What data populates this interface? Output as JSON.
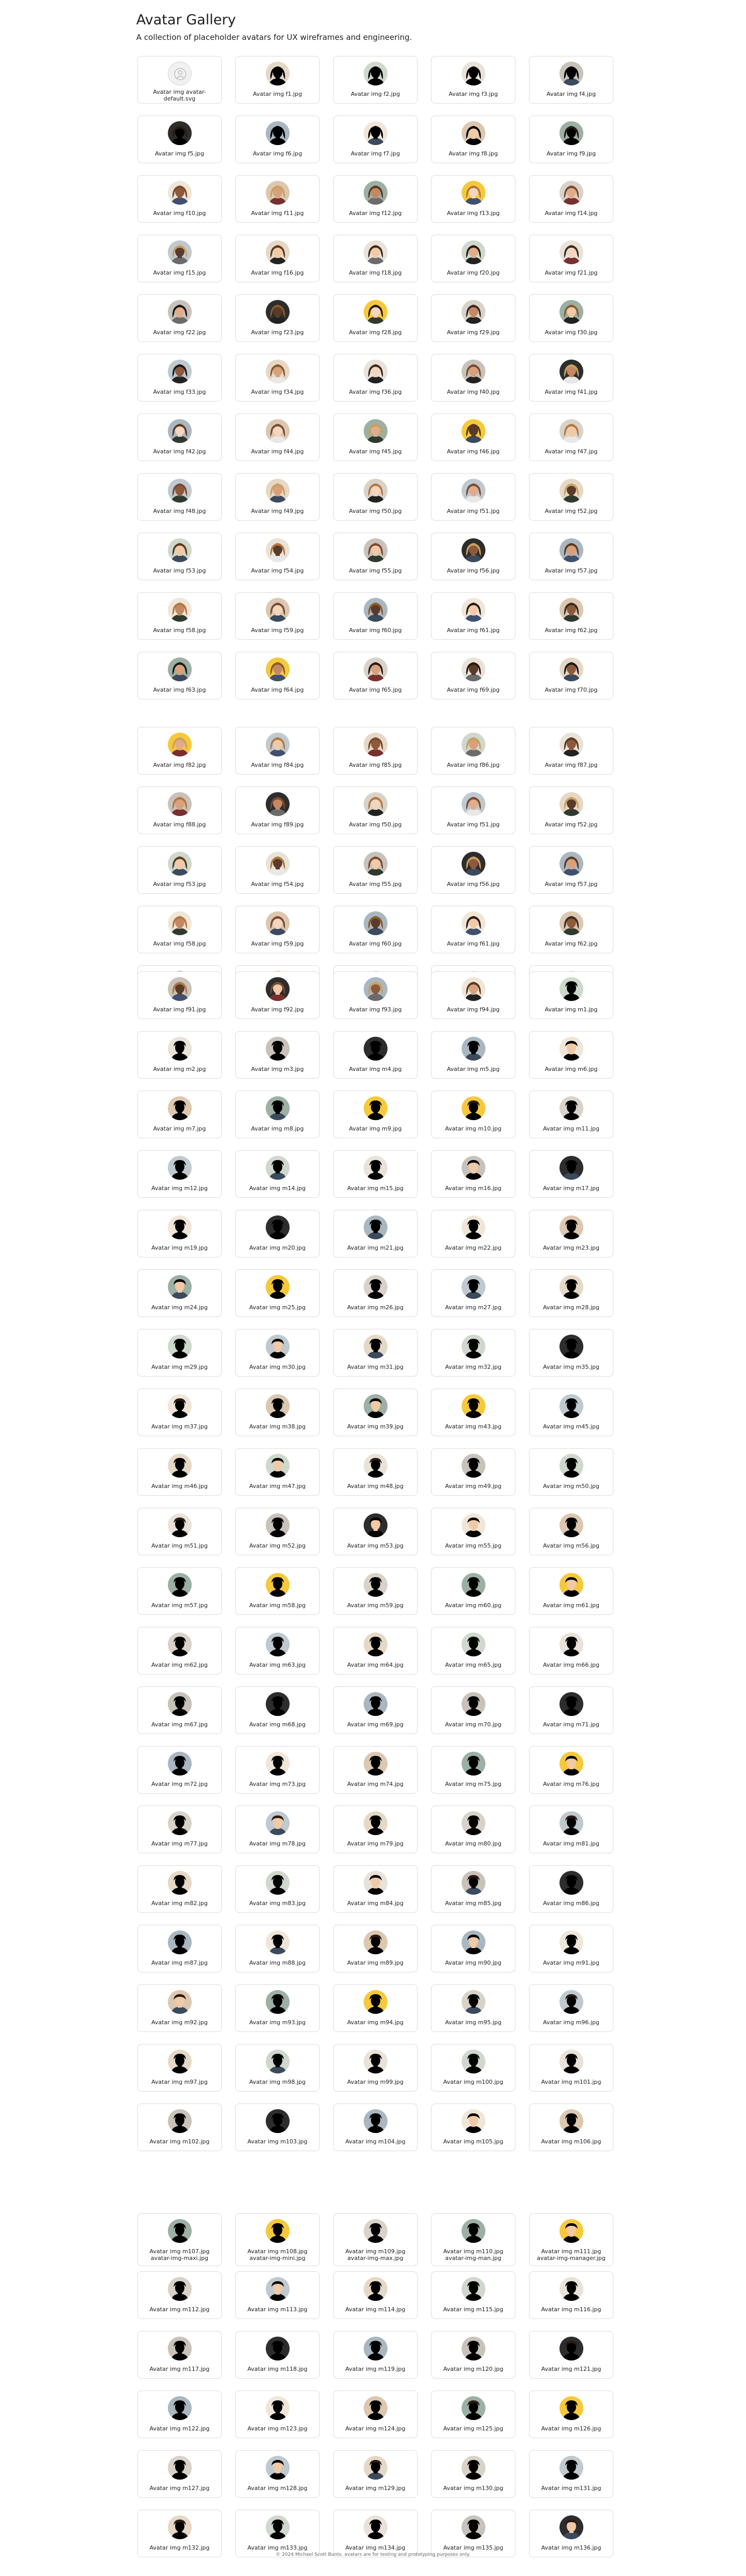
{
  "page": {
    "title": "Avatar Gallery",
    "subtitle": "A collection of placeholder avatars for UX wireframes and engineering."
  },
  "footer": {
    "text": "© 2024 Michael Scott Bunts. avatars are for testing and prototyping purposes only."
  },
  "colors": {
    "card_border": "#dcdcdc",
    "background": "#ffffff",
    "text": "#1f1f1f"
  },
  "sections": [
    [
      [
        "avatar-default.svg",
        "Avatar img avatar-default.svg"
      ],
      [
        "f1.jpg",
        "Avatar img f1.jpg"
      ],
      [
        "f2.jpg",
        "Avatar img f2.jpg"
      ],
      [
        "f3.jpg",
        "Avatar img f3.jpg"
      ],
      [
        "f4.jpg",
        "Avatar img f4.jpg"
      ],
      [
        "f5.jpg",
        "Avatar img f5.jpg"
      ],
      [
        "f6.jpg",
        "Avatar img f6.jpg"
      ],
      [
        "f7.jpg",
        "Avatar img f7.jpg"
      ],
      [
        "f8.jpg",
        "Avatar img f8.jpg"
      ],
      [
        "f9.jpg",
        "Avatar img f9.jpg"
      ],
      [
        "f10.jpg",
        "Avatar img f10.jpg"
      ],
      [
        "f11.jpg",
        "Avatar img f11.jpg"
      ],
      [
        "f12.jpg",
        "Avatar img f12.jpg"
      ],
      [
        "f13.jpg",
        "Avatar img f13.jpg"
      ],
      [
        "f14.jpg",
        "Avatar img f14.jpg"
      ],
      [
        "f15.jpg",
        "Avatar img f15.jpg"
      ],
      [
        "f16.jpg",
        "Avatar img f16.jpg"
      ],
      [
        "f18.jpg",
        "Avatar img f18.jpg"
      ],
      [
        "f20.jpg",
        "Avatar img f20.jpg"
      ],
      [
        "f21.jpg",
        "Avatar img f21.jpg"
      ],
      [
        "f22.jpg",
        "Avatar img f22.jpg"
      ],
      [
        "f23.jpg",
        "Avatar img f23.jpg"
      ],
      [
        "f28.jpg",
        "Avatar img f28.jpg"
      ],
      [
        "f29.jpg",
        "Avatar img f29.jpg"
      ],
      [
        "f30.jpg",
        "Avatar img f30.jpg"
      ],
      [
        "f33.jpg",
        "Avatar img f33.jpg"
      ],
      [
        "f34.jpg",
        "Avatar img f34.jpg"
      ],
      [
        "f36.jpg",
        "Avatar img f36.jpg"
      ],
      [
        "f40.jpg",
        "Avatar img f40.jpg"
      ],
      [
        "f41.jpg",
        "Avatar img f41.jpg"
      ],
      [
        "f42.jpg",
        "Avatar img f42.jpg"
      ],
      [
        "f44.jpg",
        "Avatar img f44.jpg"
      ],
      [
        "f45.jpg",
        "Avatar img f45.jpg"
      ],
      [
        "f46.jpg",
        "Avatar img f46.jpg"
      ],
      [
        "f47.jpg",
        "Avatar img f47.jpg"
      ],
      [
        "f48.jpg",
        "Avatar img f48.jpg"
      ],
      [
        "f49.jpg",
        "Avatar img f49.jpg"
      ],
      [
        "f50.jpg",
        "Avatar img f50.jpg"
      ],
      [
        "f51.jpg",
        "Avatar img f51.jpg"
      ],
      [
        "f52.jpg",
        "Avatar img f52.jpg"
      ],
      [
        "f53.jpg",
        "Avatar img f53.jpg"
      ],
      [
        "f54.jpg",
        "Avatar img f54.jpg"
      ],
      [
        "f55.jpg",
        "Avatar img f55.jpg"
      ],
      [
        "f56.jpg",
        "Avatar img f56.jpg"
      ],
      [
        "f57.jpg",
        "Avatar img f57.jpg"
      ],
      [
        "f58.jpg",
        "Avatar img f58.jpg"
      ],
      [
        "f59.jpg",
        "Avatar img f59.jpg"
      ],
      [
        "f60.jpg",
        "Avatar img f60.jpg"
      ],
      [
        "f61.jpg",
        "Avatar img f61.jpg"
      ],
      [
        "f62.jpg",
        "Avatar img f62.jpg"
      ],
      [
        "f63.jpg",
        "Avatar img f63.jpg"
      ],
      [
        "f64.jpg",
        "Avatar img f64.jpg"
      ],
      [
        "f65.jpg",
        "Avatar img f65.jpg"
      ],
      [
        "f69.jpg",
        "Avatar img f69.jpg"
      ],
      [
        "f70.jpg",
        "Avatar img f70.jpg"
      ]
    ],
    [
      [
        "f82.jpg",
        "Avatar img f82.jpg"
      ],
      [
        "f84.jpg",
        "Avatar img f84.jpg"
      ],
      [
        "f85.jpg",
        "Avatar img f85.jpg"
      ],
      [
        "f86.jpg",
        "Avatar img f86.jpg"
      ],
      [
        "f87.jpg",
        "Avatar img f87.jpg"
      ],
      [
        "f88.jpg",
        "Avatar img f88.jpg"
      ],
      [
        "f89.jpg",
        "Avatar img f89.jpg"
      ],
      [
        "f50.jpg",
        "Avatar img f50.jpg"
      ],
      [
        "f51.jpg",
        "Avatar img f51.jpg"
      ],
      [
        "f52.jpg",
        "Avatar img f52.jpg"
      ],
      [
        "f53.jpg",
        "Avatar img f53.jpg"
      ],
      [
        "f54.jpg",
        "Avatar img f54.jpg"
      ],
      [
        "f55.jpg",
        "Avatar img f55.jpg"
      ],
      [
        "f56.jpg",
        "Avatar img f56.jpg"
      ],
      [
        "f57.jpg",
        "Avatar img f57.jpg"
      ],
      [
        "f58.jpg",
        "Avatar img f58.jpg"
      ],
      [
        "f59.jpg",
        "Avatar img f59.jpg"
      ],
      [
        "f60.jpg",
        "Avatar img f60.jpg"
      ],
      [
        "f61.jpg",
        "Avatar img f61.jpg"
      ],
      [
        "f62.jpg",
        "Avatar img f62.jpg"
      ],
      [
        "f63.jpg",
        "Avatar img f63.jpg"
      ],
      [
        "f64.jpg",
        "Avatar img f64.jpg"
      ],
      [
        "f65.jpg",
        "Avatar img f65.jpg"
      ],
      [
        "f69.jpg",
        "Avatar img f69.jpg"
      ],
      [
        "f70.jpg",
        "Avatar img f70.jpg"
      ]
    ],
    [
      [
        "f91.jpg",
        "Avatar img f91.jpg"
      ],
      [
        "f92.jpg",
        "Avatar img f92.jpg"
      ],
      [
        "f93.jpg",
        "Avatar img f93.jpg"
      ],
      [
        "f94.jpg",
        "Avatar img f94.jpg"
      ],
      [
        "m1.jpg",
        "Avatar img m1.jpg"
      ],
      [
        "m2.jpg",
        "Avatar img m2.jpg"
      ],
      [
        "m3.jpg",
        "Avatar img m3.jpg"
      ],
      [
        "m4.jpg",
        "Avatar img m4.jpg"
      ],
      [
        "m5.jpg",
        "Avatar img m5.jpg"
      ],
      [
        "m6.jpg",
        "Avatar img m6.jpg"
      ],
      [
        "m7.jpg",
        "Avatar img m7.jpg"
      ],
      [
        "m8.jpg",
        "Avatar img m8.jpg"
      ],
      [
        "m9.jpg",
        "Avatar img m9.jpg"
      ],
      [
        "m10.jpg",
        "Avatar img m10.jpg"
      ],
      [
        "m11.jpg",
        "Avatar img m11.jpg"
      ],
      [
        "m12.jpg",
        "Avatar img m12.jpg"
      ],
      [
        "m14.jpg",
        "Avatar img m14.jpg"
      ],
      [
        "m15.jpg",
        "Avatar img m15.jpg"
      ],
      [
        "m16.jpg",
        "Avatar img m16.jpg"
      ],
      [
        "m17.jpg",
        "Avatar img m17.jpg"
      ],
      [
        "m19.jpg",
        "Avatar img m19.jpg"
      ],
      [
        "m20.jpg",
        "Avatar img m20.jpg"
      ],
      [
        "m21.jpg",
        "Avatar img m21.jpg"
      ],
      [
        "m22.jpg",
        "Avatar img m22.jpg"
      ],
      [
        "m23.jpg",
        "Avatar img m23.jpg"
      ],
      [
        "m24.jpg",
        "Avatar img m24.jpg"
      ],
      [
        "m25.jpg",
        "Avatar img m25.jpg"
      ],
      [
        "m26.jpg",
        "Avatar img m26.jpg"
      ],
      [
        "m27.jpg",
        "Avatar img m27.jpg"
      ],
      [
        "m28.jpg",
        "Avatar img m28.jpg"
      ],
      [
        "m29.jpg",
        "Avatar img m29.jpg"
      ],
      [
        "m30.jpg",
        "Avatar img m30.jpg"
      ],
      [
        "m31.jpg",
        "Avatar img m31.jpg"
      ],
      [
        "m32.jpg",
        "Avatar img m32.jpg"
      ],
      [
        "m35.jpg",
        "Avatar img m35.jpg"
      ],
      [
        "m37.jpg",
        "Avatar img m37.jpg"
      ],
      [
        "m38.jpg",
        "Avatar img m38.jpg"
      ],
      [
        "m39.jpg",
        "Avatar img m39.jpg"
      ],
      [
        "m43.jpg",
        "Avatar img m43.jpg"
      ],
      [
        "m45.jpg",
        "Avatar img m45.jpg"
      ],
      [
        "m46.jpg",
        "Avatar img m46.jpg"
      ],
      [
        "m47.jpg",
        "Avatar img m47.jpg"
      ],
      [
        "m48.jpg",
        "Avatar img m48.jpg"
      ],
      [
        "m49.jpg",
        "Avatar img m49.jpg"
      ],
      [
        "m50.jpg",
        "Avatar img m50.jpg"
      ],
      [
        "m51.jpg",
        "Avatar img m51.jpg"
      ],
      [
        "m52.jpg",
        "Avatar img m52.jpg"
      ],
      [
        "m53.jpg",
        "Avatar img m53.jpg"
      ],
      [
        "m55.jpg",
        "Avatar img m55.jpg"
      ],
      [
        "m56.jpg",
        "Avatar img m56.jpg"
      ],
      [
        "m57.jpg",
        "Avatar img m57.jpg"
      ],
      [
        "m58.jpg",
        "Avatar img m58.jpg"
      ],
      [
        "m59.jpg",
        "Avatar img m59.jpg"
      ],
      [
        "m60.jpg",
        "Avatar img m60.jpg"
      ],
      [
        "m61.jpg",
        "Avatar img m61.jpg"
      ],
      [
        "m62.jpg",
        "Avatar img m62.jpg"
      ],
      [
        "m63.jpg",
        "Avatar img m63.jpg"
      ],
      [
        "m64.jpg",
        "Avatar img m64.jpg"
      ],
      [
        "m65.jpg",
        "Avatar img m65.jpg"
      ],
      [
        "m66.jpg",
        "Avatar img m66.jpg"
      ],
      [
        "m67.jpg",
        "Avatar img m67.jpg"
      ],
      [
        "m68.jpg",
        "Avatar img m68.jpg"
      ],
      [
        "m69.jpg",
        "Avatar img m69.jpg"
      ],
      [
        "m70.jpg",
        "Avatar img m70.jpg"
      ],
      [
        "m71.jpg",
        "Avatar img m71.jpg"
      ],
      [
        "m72.jpg",
        "Avatar img m72.jpg"
      ],
      [
        "m73.jpg",
        "Avatar img m73.jpg"
      ],
      [
        "m74.jpg",
        "Avatar img m74.jpg"
      ],
      [
        "m75.jpg",
        "Avatar img m75.jpg"
      ],
      [
        "m76.jpg",
        "Avatar img m76.jpg"
      ],
      [
        "m77.jpg",
        "Avatar img m77.jpg"
      ],
      [
        "m78.jpg",
        "Avatar img m78.jpg"
      ],
      [
        "m79.jpg",
        "Avatar img m79.jpg"
      ],
      [
        "m80.jpg",
        "Avatar img m80.jpg"
      ],
      [
        "m81.jpg",
        "Avatar img m81.jpg"
      ],
      [
        "m82.jpg",
        "Avatar img m82.jpg"
      ],
      [
        "m83.jpg",
        "Avatar img m83.jpg"
      ],
      [
        "m84.jpg",
        "Avatar img m84.jpg"
      ],
      [
        "m85.jpg",
        "Avatar img m85.jpg"
      ],
      [
        "m86.jpg",
        "Avatar img m86.jpg"
      ],
      [
        "m87.jpg",
        "Avatar img m87.jpg"
      ],
      [
        "m88.jpg",
        "Avatar img m88.jpg"
      ],
      [
        "m89.jpg",
        "Avatar img m89.jpg"
      ],
      [
        "m90.jpg",
        "Avatar img m90.jpg"
      ],
      [
        "m91.jpg",
        "Avatar img m91.jpg"
      ],
      [
        "m92.jpg",
        "Avatar img m92.jpg"
      ],
      [
        "m93.jpg",
        "Avatar img m93.jpg"
      ],
      [
        "m94.jpg",
        "Avatar img m94.jpg"
      ],
      [
        "m95.jpg",
        "Avatar img m95.jpg"
      ],
      [
        "m96.jpg",
        "Avatar img m96.jpg"
      ],
      [
        "m97.jpg",
        "Avatar img m97.jpg"
      ],
      [
        "m98.jpg",
        "Avatar img m98.jpg"
      ],
      [
        "m99.jpg",
        "Avatar img m99.jpg"
      ],
      [
        "m100.jpg",
        "Avatar img m100.jpg"
      ],
      [
        "m101.jpg",
        "Avatar img m101.jpg"
      ],
      [
        "m102.jpg",
        "Avatar img m102.jpg"
      ],
      [
        "m103.jpg",
        "Avatar img m103.jpg"
      ],
      [
        "m104.jpg",
        "Avatar img m104.jpg"
      ],
      [
        "m105.jpg",
        "Avatar img m105.jpg"
      ],
      [
        "m106.jpg",
        "Avatar img m106.jpg"
      ]
    ],
    [
      [
        "m107.jpg",
        "Avatar img m107.jpg avatar-img-maxi.jpg"
      ],
      [
        "m108.jpg",
        "Avatar img m108.jpg avatar-img-mini.jpg"
      ],
      [
        "m109.jpg",
        "Avatar img m109.jpg avatar-img-max.jpg"
      ],
      [
        "m110.jpg",
        "Avatar img m110.jpg avatar-img-man.jpg"
      ],
      [
        "m111.jpg",
        "Avatar img m111.jpg avatar-img-manager.jpg"
      ]
    ],
    [
      [
        "m112.jpg",
        "Avatar img m112.jpg"
      ],
      [
        "m113.jpg",
        "Avatar img m113.jpg"
      ],
      [
        "m114.jpg",
        "Avatar img m114.jpg"
      ],
      [
        "m115.jpg",
        "Avatar img m115.jpg"
      ],
      [
        "m116.jpg",
        "Avatar img m116.jpg"
      ],
      [
        "m117.jpg",
        "Avatar img m117.jpg"
      ],
      [
        "m118.jpg",
        "Avatar img m118.jpg"
      ],
      [
        "m119.jpg",
        "Avatar img m119.jpg"
      ],
      [
        "m120.jpg",
        "Avatar img m120.jpg"
      ],
      [
        "m121.jpg",
        "Avatar img m121.jpg"
      ],
      [
        "m122.jpg",
        "Avatar img m122.jpg"
      ],
      [
        "m123.jpg",
        "Avatar img m123.jpg"
      ],
      [
        "m124.jpg",
        "Avatar img m124.jpg"
      ],
      [
        "m125.jpg",
        "Avatar img m125.jpg"
      ],
      [
        "m126.jpg",
        "Avatar img m126.jpg"
      ],
      [
        "m127.jpg",
        "Avatar img m127.jpg"
      ],
      [
        "m128.jpg",
        "Avatar img m128.jpg"
      ],
      [
        "m129.jpg",
        "Avatar img m129.jpg"
      ],
      [
        "m130.jpg",
        "Avatar img m130.jpg"
      ],
      [
        "m131.jpg",
        "Avatar img m131.jpg"
      ],
      [
        "m132.jpg",
        "Avatar img m132.jpg"
      ],
      [
        "m133.jpg",
        "Avatar img m133.jpg"
      ],
      [
        "m134.jpg",
        "Avatar img m134.jpg"
      ],
      [
        "m135.jpg",
        "Avatar img m135.jpg"
      ],
      [
        "m136.jpg",
        "Avatar img m136.jpg"
      ]
    ]
  ]
}
